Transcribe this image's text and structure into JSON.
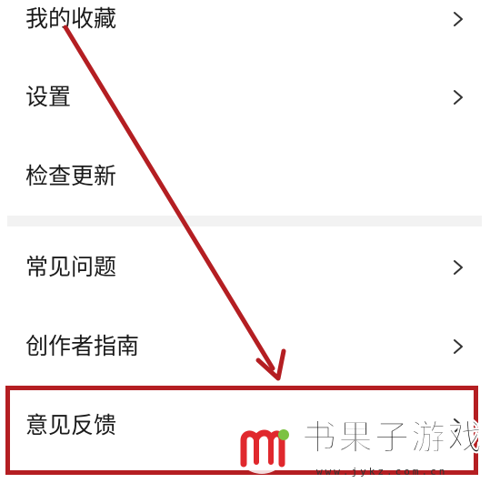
{
  "menu": {
    "group1": [
      {
        "label": "我的收藏",
        "has_chevron": true
      },
      {
        "label": "设置",
        "has_chevron": true
      },
      {
        "label": "检查更新",
        "has_chevron": false
      }
    ],
    "group2": [
      {
        "label": "常见问题",
        "has_chevron": true
      },
      {
        "label": "创作者指南",
        "has_chevron": true
      },
      {
        "label": "意见反馈",
        "has_chevron": true
      }
    ]
  },
  "annotation": {
    "highlighted_item": "意见反馈",
    "color": "#b41e22"
  },
  "watermark": {
    "title": "书果子游戏",
    "url": "www.jykz.com.cn"
  },
  "icons": {
    "chevron": "chevron-right-icon",
    "watermark_logo": "m-logo-icon"
  }
}
